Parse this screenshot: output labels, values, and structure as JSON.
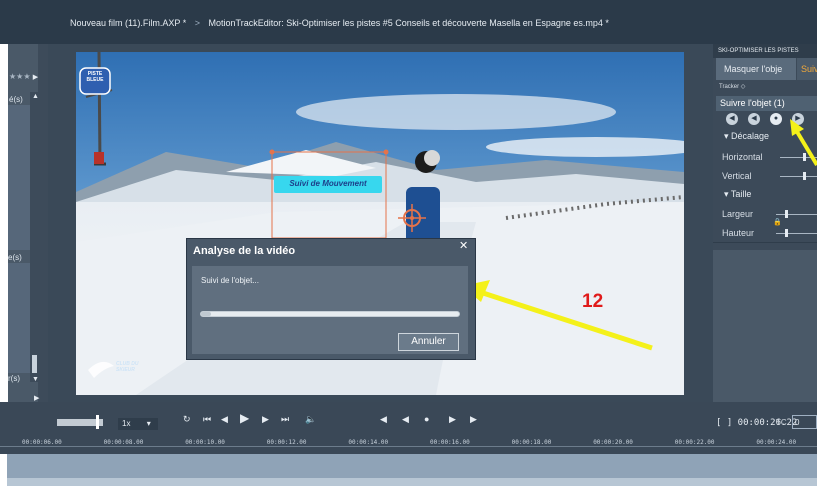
{
  "titlebar": {
    "project": "Nouveau film (11).Film.AXP *",
    "separator": ">",
    "editor": "MotionTrackEditor: Ski-Optimiser les pistes #5  Conseils et découverte Masella en Espagne es.mp4 *"
  },
  "left_panel": {
    "stars": "★★★",
    "label_1": "é(s)",
    "label_2": "e(s)",
    "label_3": "r(s)"
  },
  "video": {
    "badge": "PISTE BLEUE",
    "tracking_label": "Suivi de Mouvement",
    "watermark": "CLUB DU SKIEUR"
  },
  "right_panel": {
    "header": "SKI-OPTIMISER LES PISTES",
    "tab_mask": "Masquer l'obje",
    "tab_follow": "Suiv",
    "tracker_label": "Tracker",
    "follow_object": "Suivre l'objet (1)",
    "offset_section": "Décalage",
    "horizontal": "Horizontal",
    "vertical": "Vertical",
    "size_section": "Taille",
    "width": "Largeur",
    "height": "Hauteur"
  },
  "dialog": {
    "title": "Analyse de la vidéo",
    "message": "Suivi de l'objet...",
    "progress": 0.04,
    "cancel": "Annuler"
  },
  "annotation": {
    "number": "12",
    "color": "#e01a1a",
    "arrow_color": "#f4f11a"
  },
  "timeline": {
    "speed": "1x",
    "timecode": "[ ] 00:00:26.22",
    "tc_label": "TC",
    "tc_value": "0",
    "ticks": [
      "00:00:06.00",
      "00:00:08.00",
      "00:00:10.00",
      "00:00:12.00",
      "00:00:14.00",
      "00:00:16.00",
      "00:00:18.00",
      "00:00:20.00",
      "00:00:22.00",
      "00:00:24.00"
    ]
  }
}
